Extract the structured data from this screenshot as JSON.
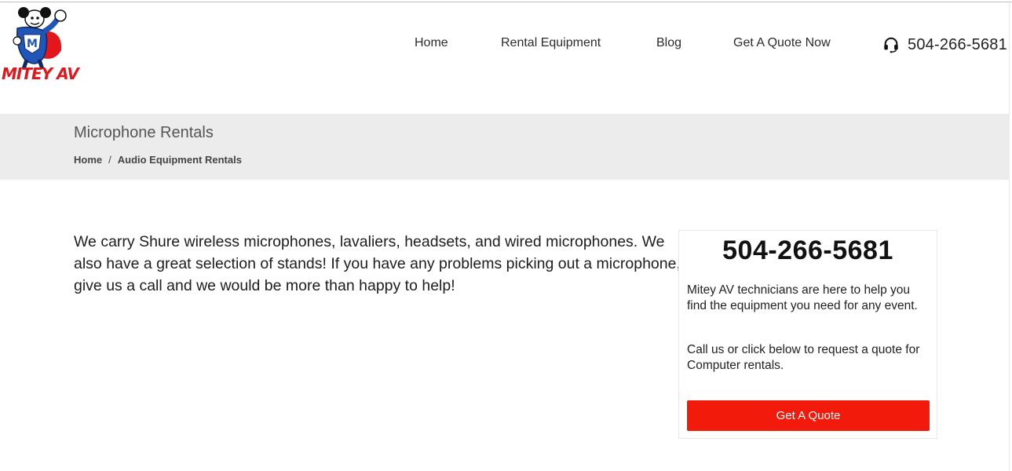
{
  "header": {
    "logo_text": "MITEY AV",
    "nav": [
      {
        "label": "Home"
      },
      {
        "label": "Rental Equipment"
      },
      {
        "label": "Blog"
      },
      {
        "label": "Get A Quote Now"
      }
    ],
    "phone": "504-266-5681",
    "phone_icon": "headset-icon"
  },
  "title_band": {
    "title": "Microphone Rentals",
    "breadcrumb": [
      "Home",
      "/",
      "Audio Equipment Rentals"
    ]
  },
  "main": {
    "intro": "We carry Shure wireless microphones, lavaliers, headsets, and wired microphones. We also have a great selection of stands! If you have any problems picking out a microphone, give us a call and we would be more than happy to help!"
  },
  "sidebar": {
    "phone": "504-266-5681",
    "paragraph1": "Mitey AV technicians are here to help you find the equipment you need for any event.",
    "paragraph2": "Call us or click below to request a quote for Computer rentals.",
    "button_label": "Get A Quote"
  },
  "colors": {
    "brand_red": "#e3161b",
    "button_red": "#f21a0b",
    "band_gray": "#ececec",
    "logo_blue": "#1f56b8"
  }
}
